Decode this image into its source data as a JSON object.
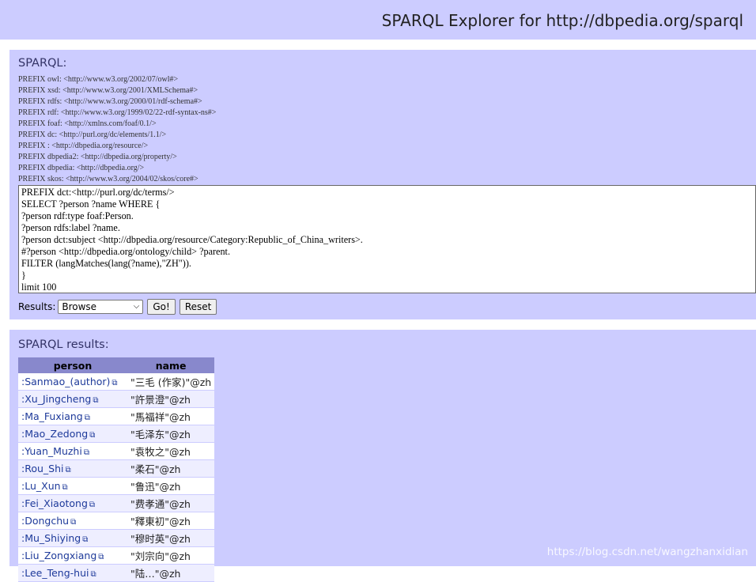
{
  "header": {
    "title": "SPARQL Explorer for http://dbpedia.org/sparql"
  },
  "query_panel": {
    "heading": "SPARQL:",
    "prefixes": [
      "PREFIX owl: <http://www.w3.org/2002/07/owl#>",
      "PREFIX xsd: <http://www.w3.org/2001/XMLSchema#>",
      "PREFIX rdfs: <http://www.w3.org/2000/01/rdf-schema#>",
      "PREFIX rdf: <http://www.w3.org/1999/02/22-rdf-syntax-ns#>",
      "PREFIX foaf: <http://xmlns.com/foaf/0.1/>",
      "PREFIX dc: <http://purl.org/dc/elements/1.1/>",
      "PREFIX : <http://dbpedia.org/resource/>",
      "PREFIX dbpedia2: <http://dbpedia.org/property/>",
      "PREFIX dbpedia: <http://dbpedia.org/>",
      "PREFIX skos: <http://www.w3.org/2004/02/skos/core#>"
    ],
    "query_lines": [
      "PREFIX dct:<http://purl.org/dc/terms/>",
      "SELECT ?person ?name WHERE {",
      "?person rdf:type foaf:Person.",
      "?person rdfs:label ?name.",
      "?person dct:subject <http://dbpedia.org/resource/Category:Republic_of_China_writers>.",
      "#?person <http://dbpedia.org/ontology/child> ?parent.",
      "FILTER (langMatches(lang(?name),\"ZH\")).",
      "}",
      "limit 100"
    ],
    "results_label": "Results:",
    "results_select": "Browse",
    "go_label": "Go!",
    "reset_label": "Reset"
  },
  "results_panel": {
    "heading": "SPARQL results:",
    "columns": [
      "person",
      "name"
    ],
    "rows": [
      {
        "person": ":Sanmao_(author)",
        "name": "\"三毛 (作家)\"@zh"
      },
      {
        "person": ":Xu_Jingcheng",
        "name": "\"許景澄\"@zh"
      },
      {
        "person": ":Ma_Fuxiang",
        "name": "\"馬福祥\"@zh"
      },
      {
        "person": ":Mao_Zedong",
        "name": "\"毛泽东\"@zh"
      },
      {
        "person": ":Yuan_Muzhi",
        "name": "\"袁牧之\"@zh"
      },
      {
        "person": ":Rou_Shi",
        "name": "\"柔石\"@zh"
      },
      {
        "person": ":Lu_Xun",
        "name": "\"鲁迅\"@zh"
      },
      {
        "person": ":Fei_Xiaotong",
        "name": "\"费孝通\"@zh"
      },
      {
        "person": ":Dongchu",
        "name": "\"釋東初\"@zh"
      },
      {
        "person": ":Mu_Shiying",
        "name": "\"穆时英\"@zh"
      },
      {
        "person": ":Liu_Zongxiang",
        "name": "\"刘宗向\"@zh"
      },
      {
        "person": ":Lee_Teng-hui",
        "name": "\"陆…\"@zh"
      }
    ]
  },
  "watermark": "https://blog.csdn.net/wangzhanxidian"
}
